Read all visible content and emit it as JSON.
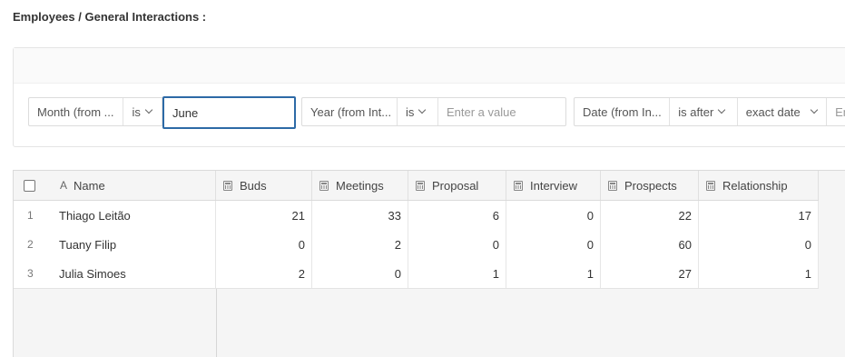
{
  "breadcrumb": "Employees / General Interactions :",
  "filters": [
    {
      "field": "Month (from ...",
      "operator": "is",
      "value": "June"
    },
    {
      "field": "Year (from Int...",
      "operator": "is",
      "placeholder": "Enter a value"
    },
    {
      "field": "Date (from In...",
      "operator": "is after",
      "mode": "exact date",
      "placeholder": "En"
    }
  ],
  "table": {
    "columns": [
      "Name",
      "Buds",
      "Meetings",
      "Proposal",
      "Interview",
      "Prospects",
      "Relationship"
    ],
    "rows": [
      {
        "num": "1",
        "name": "Thiago Leitão",
        "values": [
          "21",
          "33",
          "6",
          "0",
          "22",
          "17"
        ]
      },
      {
        "num": "2",
        "name": "Tuany Filip",
        "values": [
          "0",
          "2",
          "0",
          "0",
          "60",
          "0"
        ]
      },
      {
        "num": "3",
        "name": "Julia Simoes",
        "values": [
          "2",
          "0",
          "1",
          "1",
          "27",
          "1"
        ]
      }
    ]
  },
  "colors": {
    "focus": "#2d6aa6",
    "grid_bg": "#f5f5f5"
  },
  "icons": {
    "name_column": "text-field-icon",
    "number_columns": "calculator-icon",
    "select_all": "checkbox-icon"
  }
}
